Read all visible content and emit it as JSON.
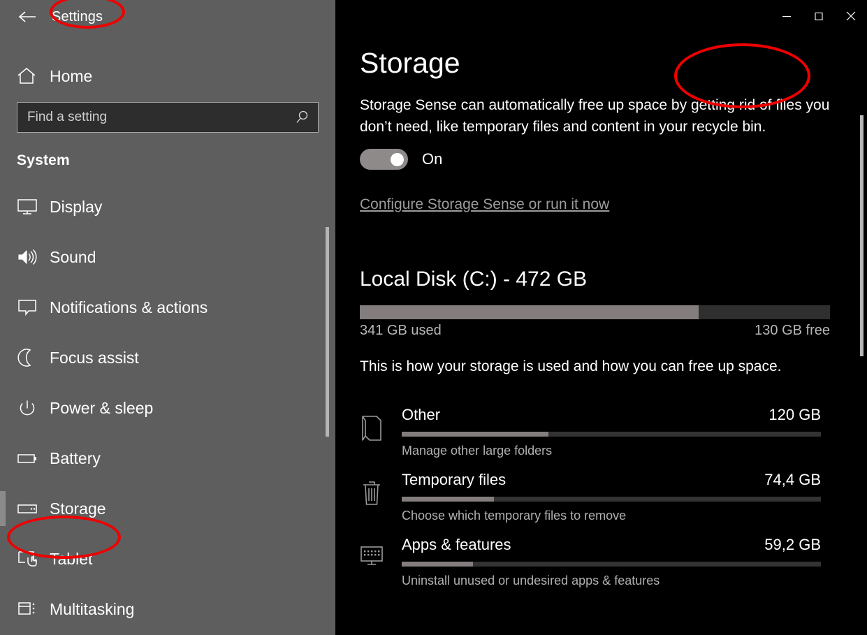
{
  "window": {
    "titlebar": {
      "back_icon": "back-arrow-icon",
      "title": "Settings",
      "minimize_label": "─",
      "maximize_label": "☐",
      "close_label": "✕"
    }
  },
  "sidebar": {
    "home": {
      "icon": "home-icon",
      "label": "Home"
    },
    "search": {
      "icon": "search-icon",
      "placeholder": "Find a setting",
      "value": ""
    },
    "section": "System",
    "items": [
      {
        "icon": "monitor-icon",
        "label": "Display",
        "selected": false
      },
      {
        "icon": "speaker-icon",
        "label": "Sound",
        "selected": false
      },
      {
        "icon": "speech-bubble-icon",
        "label": "Notifications & actions",
        "selected": false
      },
      {
        "icon": "moon-icon",
        "label": "Focus assist",
        "selected": false
      },
      {
        "icon": "power-icon",
        "label": "Power & sleep",
        "selected": false
      },
      {
        "icon": "battery-icon",
        "label": "Battery",
        "selected": false
      },
      {
        "icon": "drive-icon",
        "label": "Storage",
        "selected": true
      },
      {
        "icon": "tablet-icon",
        "label": "Tablet",
        "selected": false
      },
      {
        "icon": "multitasking-icon",
        "label": "Multitasking",
        "selected": false
      }
    ]
  },
  "main": {
    "page_title": "Storage",
    "storage_sense": {
      "description": "Storage Sense can automatically free up space by getting rid of files you don’t need, like temporary files and content in your recycle bin.",
      "toggle_state": "On",
      "toggle_on": true,
      "link": "Configure Storage Sense or run it now"
    },
    "disk": {
      "title": "Local Disk (C:) - 472 GB",
      "used_label": "341 GB used",
      "free_label": "130 GB free",
      "used_percent": 72,
      "description": "This is how your storage is used and how you can free up space."
    },
    "categories": [
      {
        "icon": "document-icon",
        "name": "Other",
        "size": "120 GB",
        "percent": 35,
        "sub": "Manage other large folders"
      },
      {
        "icon": "trash-icon",
        "name": "Temporary files",
        "size": "74,4 GB",
        "percent": 22,
        "sub": "Choose which temporary files to remove"
      },
      {
        "icon": "apps-monitor-icon",
        "name": "Apps & features",
        "size": "59,2 GB",
        "percent": 17,
        "sub": "Uninstall unused or undesired apps & features"
      }
    ]
  },
  "annotations": [
    {
      "name": "settings-title-highlight",
      "color": "#ee0000"
    },
    {
      "name": "storage-nav-highlight",
      "color": "#ee0000"
    },
    {
      "name": "storage-page-title-highlight",
      "color": "#ee0000"
    }
  ],
  "colors": {
    "sidebar_bg": "#5e5e5e",
    "main_bg": "#000000",
    "bar_fill": "#837d7d",
    "bar_track": "#2f2f2f",
    "annotation": "#ee0000"
  }
}
